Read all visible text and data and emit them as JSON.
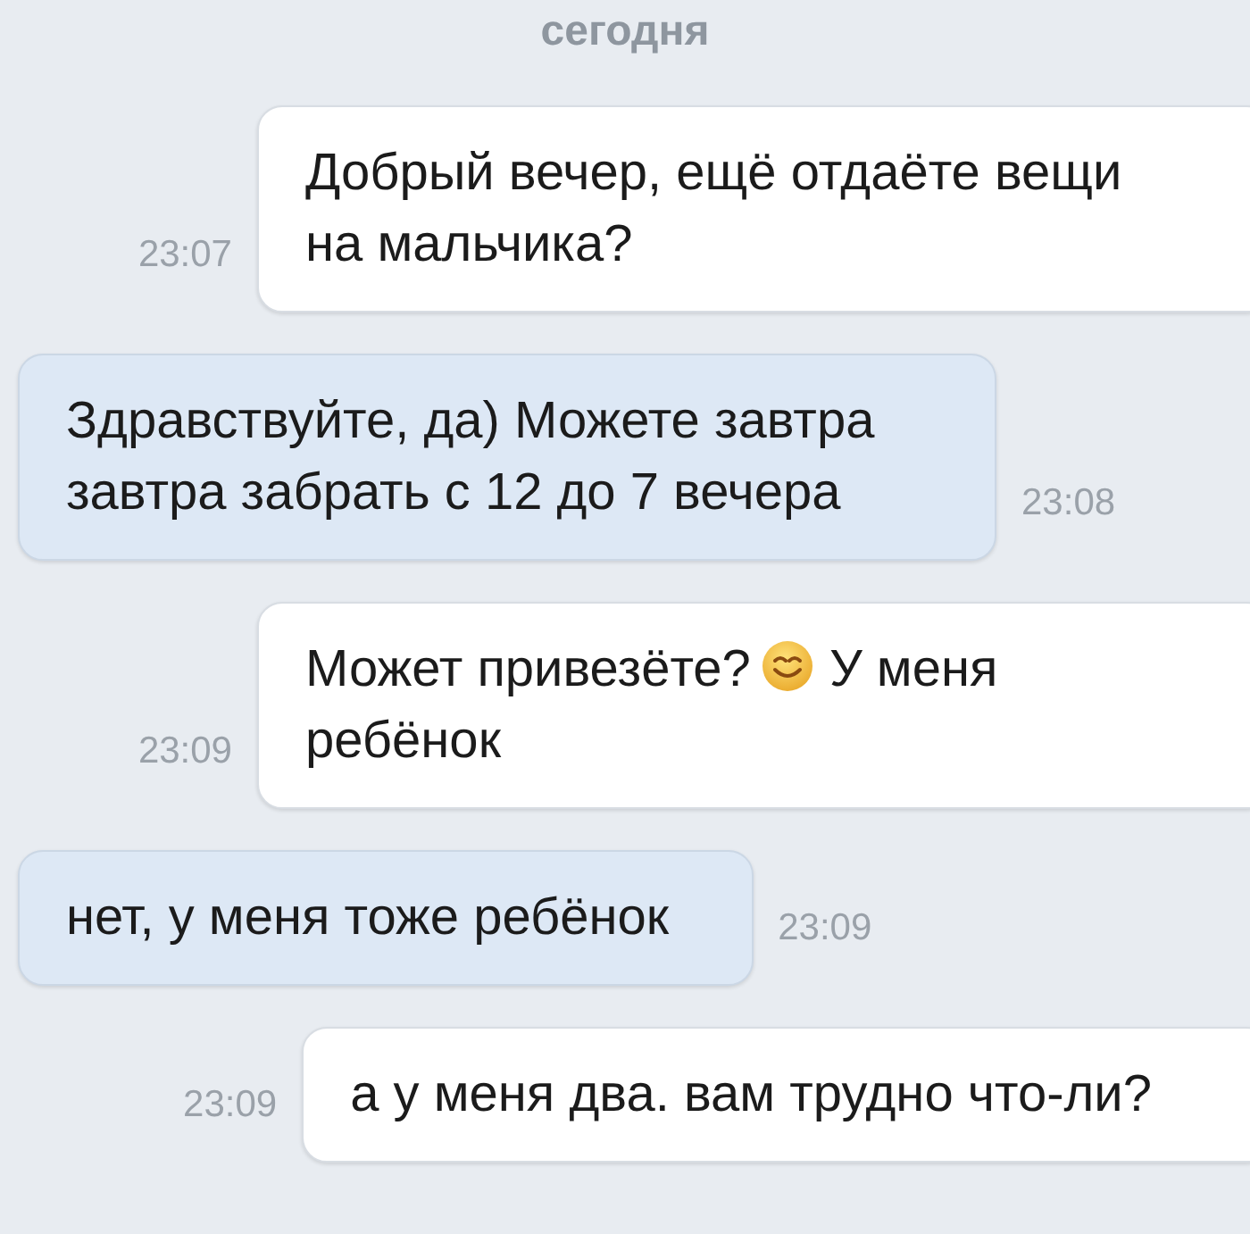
{
  "date_label": "сегодня",
  "messages": [
    {
      "kind": "outgoing",
      "time": "23:07",
      "parts": [
        {
          "kind": "text",
          "text": "Добрый вечер, ещё отдаёте вещи на мальчика?"
        }
      ]
    },
    {
      "kind": "incoming",
      "time": "23:08",
      "parts": [
        {
          "kind": "text",
          "text": "Здравствуйте, да) Можете завтра завтра забрать с 12 до 7 вечера"
        }
      ]
    },
    {
      "kind": "outgoing",
      "time": "23:09",
      "parts": [
        {
          "kind": "text",
          "text": "Может привезёте?"
        },
        {
          "kind": "emoji"
        },
        {
          "kind": "text",
          "text": "У меня"
        },
        {
          "kind": "text",
          "text": "ребёнок"
        }
      ]
    },
    {
      "kind": "incoming",
      "time": "23:09",
      "parts": [
        {
          "kind": "text",
          "text": "нет, у меня тоже ребёнок"
        }
      ]
    },
    {
      "kind": "outgoing",
      "time": "23:09",
      "parts": [
        {
          "kind": "text",
          "text": "а у меня два. вам трудно что-ли?"
        }
      ]
    }
  ]
}
